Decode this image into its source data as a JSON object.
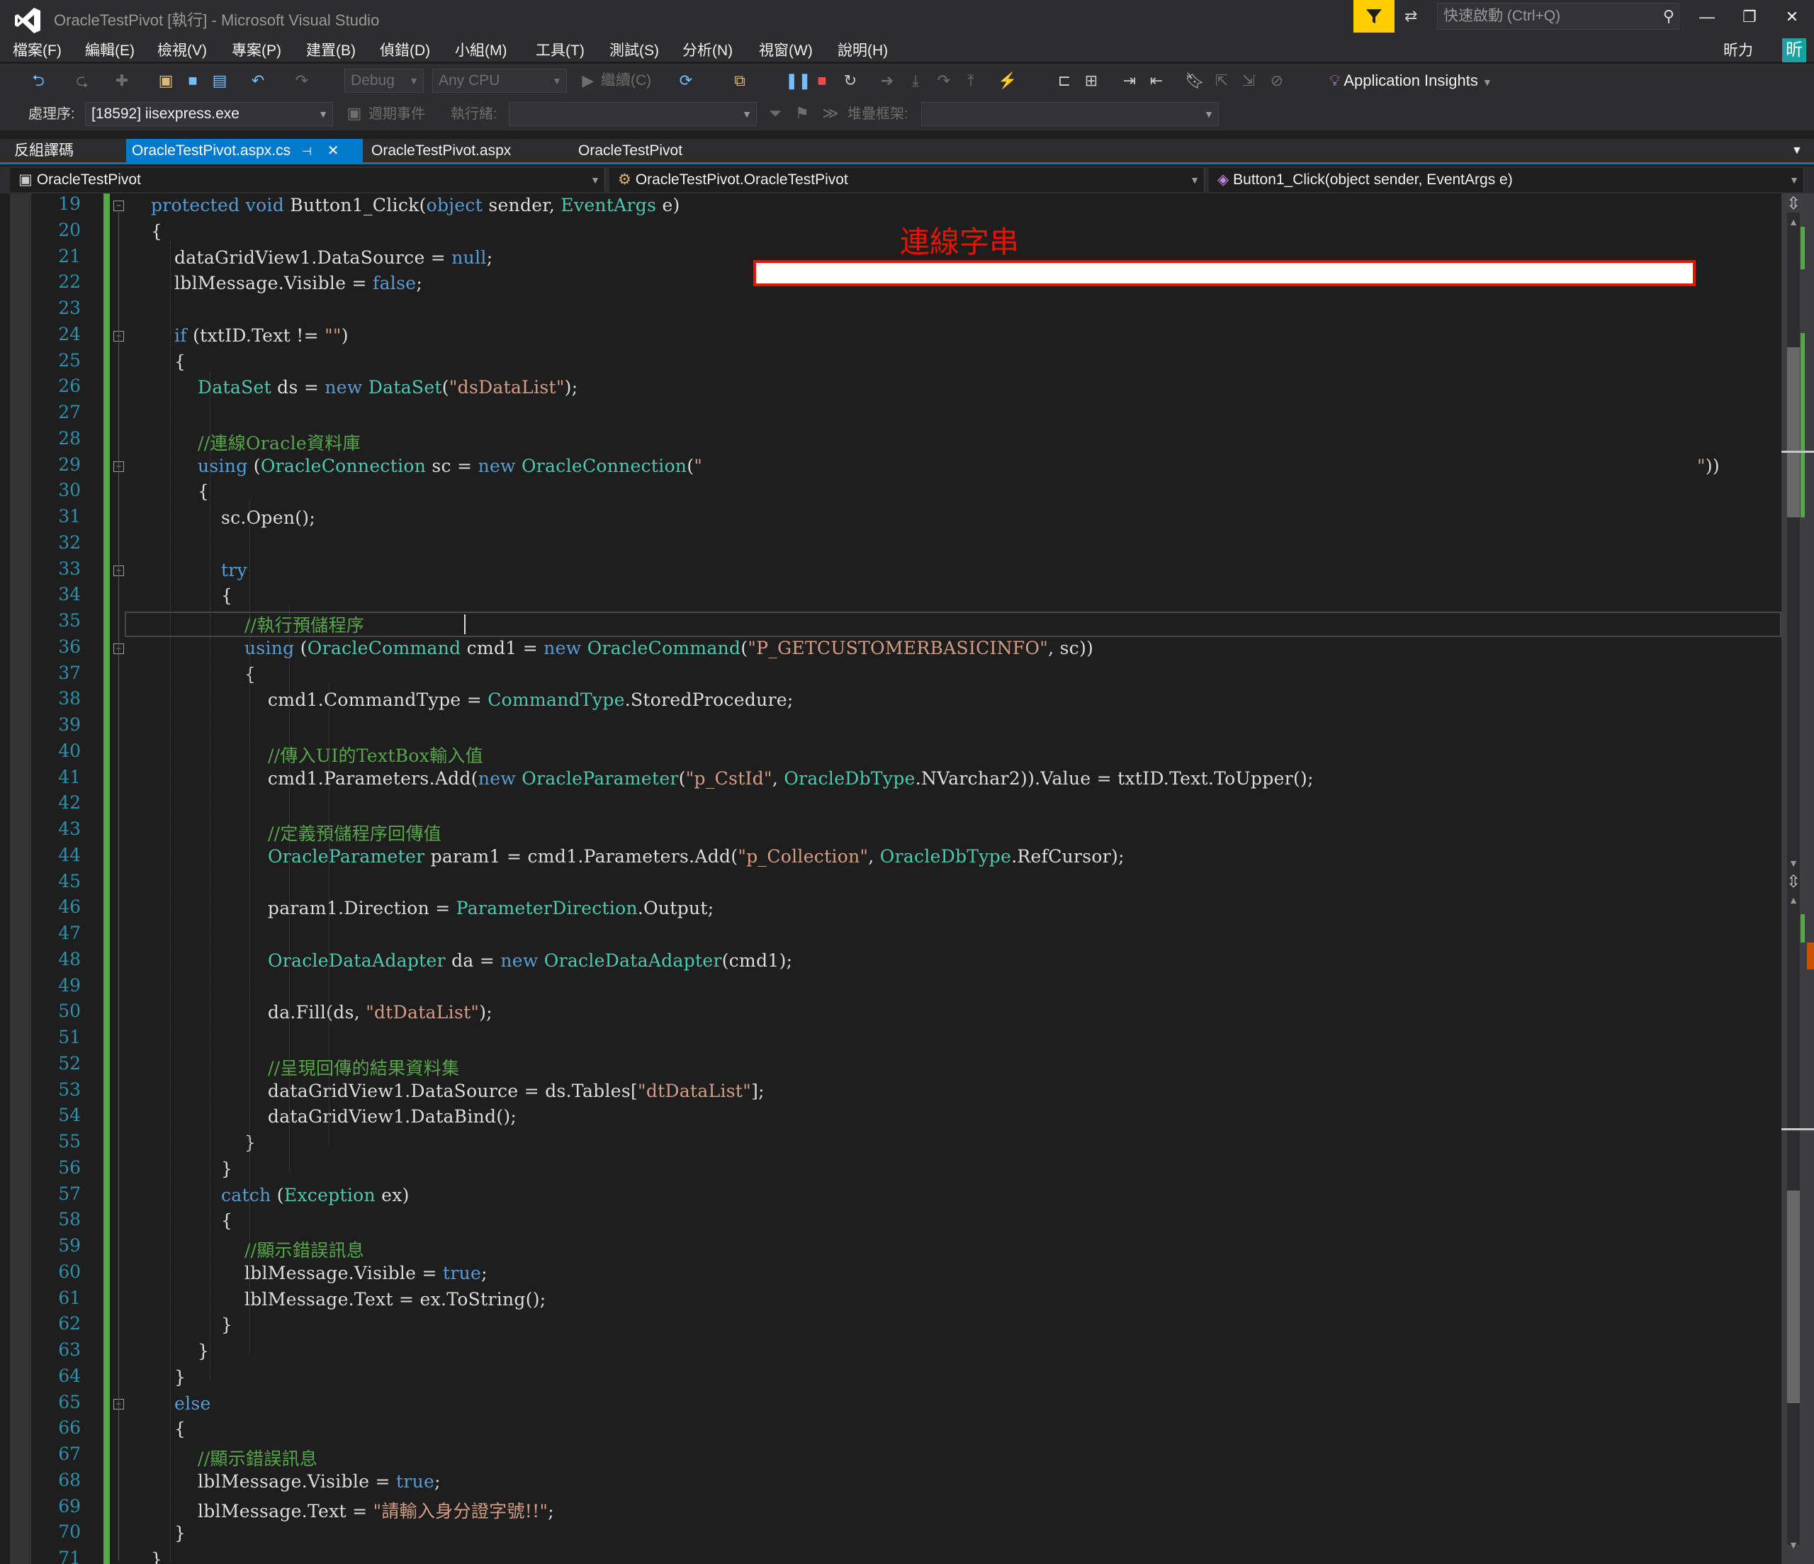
{
  "window": {
    "title": "OracleTestPivot [執行] - Microsoft Visual Studio",
    "quick_launch_placeholder": "快速啟動 (Ctrl+Q)",
    "minimize": "—",
    "maximize": "❐",
    "close": "✕"
  },
  "menu": {
    "items": [
      "檔案(F)",
      "編輯(E)",
      "檢視(V)",
      "專案(P)",
      "建置(B)",
      "偵錯(D)",
      "小組(M)",
      "工具(T)",
      "測試(S)",
      "分析(N)",
      "視窗(W)",
      "說明(H)"
    ],
    "user_name": "昕力",
    "user_avatar": "昕"
  },
  "toolbar": {
    "config": "Debug",
    "platform": "Any CPU",
    "continue_label": "繼續(C)",
    "app_insights": "Application Insights"
  },
  "debug_location": {
    "process_label": "處理序:",
    "process_value": "[18592] iisexpress.exe",
    "lifecycle_label": "週期事件",
    "thread_label": "執行緒:",
    "stack_label": "堆疊框架:"
  },
  "tabs": {
    "left_panel": "反組譯碼",
    "documents": [
      {
        "label": "OracleTestPivot.aspx.cs",
        "active": true
      },
      {
        "label": "OracleTestPivot.aspx",
        "active": false
      },
      {
        "label": "OracleTestPivot",
        "active": false
      }
    ]
  },
  "navigation": {
    "project": "OracleTestPivot",
    "type": "OracleTestPivot.OracleTestPivot",
    "member": "Button1_Click(object sender, EventArgs e)"
  },
  "annotation": {
    "label": "連線字串"
  },
  "code": {
    "lines": [
      {
        "n": 19,
        "fold": true,
        "tokens": [
          [
            "",
            "    "
          ],
          [
            "kw",
            "protected"
          ],
          [
            "",
            " "
          ],
          [
            "kw",
            "void"
          ],
          [
            "",
            " Button1_Click("
          ],
          [
            "kw",
            "object"
          ],
          [
            "",
            " sender, "
          ],
          [
            "ty",
            "EventArgs"
          ],
          [
            "",
            " e)"
          ]
        ]
      },
      {
        "n": 20,
        "tokens": [
          [
            "",
            "    {"
          ]
        ]
      },
      {
        "n": 21,
        "tokens": [
          [
            "",
            "        dataGridView1.DataSource = "
          ],
          [
            "kw",
            "null"
          ],
          [
            "",
            ";"
          ]
        ]
      },
      {
        "n": 22,
        "tokens": [
          [
            "",
            "        lblMessage.Visible = "
          ],
          [
            "kw",
            "false"
          ],
          [
            "",
            ";"
          ]
        ]
      },
      {
        "n": 23,
        "tokens": [
          [
            "",
            ""
          ]
        ]
      },
      {
        "n": 24,
        "fold": true,
        "tokens": [
          [
            "",
            "        "
          ],
          [
            "kw",
            "if"
          ],
          [
            "",
            " (txtID.Text != "
          ],
          [
            "st",
            "\"\""
          ],
          [
            "",
            ")"
          ]
        ]
      },
      {
        "n": 25,
        "tokens": [
          [
            "",
            "        {"
          ]
        ]
      },
      {
        "n": 26,
        "tokens": [
          [
            "",
            "            "
          ],
          [
            "ty",
            "DataSet"
          ],
          [
            "",
            " ds = "
          ],
          [
            "kw",
            "new"
          ],
          [
            "",
            " "
          ],
          [
            "ty",
            "DataSet"
          ],
          [
            "",
            "("
          ],
          [
            "st",
            "\"dsDataList\""
          ],
          [
            "",
            ");"
          ]
        ]
      },
      {
        "n": 27,
        "tokens": [
          [
            "",
            ""
          ]
        ]
      },
      {
        "n": 28,
        "tokens": [
          [
            "",
            "            "
          ],
          [
            "cm",
            "//連線Oracle資料庫"
          ]
        ]
      },
      {
        "n": 29,
        "fold": true,
        "tokens": [
          [
            "",
            "            "
          ],
          [
            "kw",
            "using"
          ],
          [
            "",
            " ("
          ],
          [
            "ty",
            "OracleConnection"
          ],
          [
            "",
            " sc = "
          ],
          [
            "kw",
            "new"
          ],
          [
            "",
            " "
          ],
          [
            "ty",
            "OracleConnection"
          ],
          [
            "",
            "("
          ],
          [
            "st",
            "\""
          ]
        ]
      },
      {
        "n": 30,
        "tokens": [
          [
            "",
            "            {"
          ]
        ]
      },
      {
        "n": 31,
        "tokens": [
          [
            "",
            "                sc.Open();"
          ]
        ]
      },
      {
        "n": 32,
        "tokens": [
          [
            "",
            ""
          ]
        ]
      },
      {
        "n": 33,
        "fold": true,
        "tokens": [
          [
            "",
            "                "
          ],
          [
            "kw",
            "try"
          ]
        ]
      },
      {
        "n": 34,
        "tokens": [
          [
            "",
            "                {"
          ]
        ]
      },
      {
        "n": 35,
        "tokens": [
          [
            "",
            "                    "
          ],
          [
            "cm",
            "//執行預儲程序"
          ]
        ]
      },
      {
        "n": 36,
        "fold": true,
        "tokens": [
          [
            "",
            "                    "
          ],
          [
            "kw",
            "using"
          ],
          [
            "",
            " ("
          ],
          [
            "ty",
            "OracleCommand"
          ],
          [
            "",
            " cmd1 = "
          ],
          [
            "kw",
            "new"
          ],
          [
            "",
            " "
          ],
          [
            "ty",
            "OracleCommand"
          ],
          [
            "",
            "("
          ],
          [
            "st",
            "\"P_GETCUSTOMERBASICINFO\""
          ],
          [
            "",
            ", sc))"
          ]
        ]
      },
      {
        "n": 37,
        "tokens": [
          [
            "",
            "                    {"
          ]
        ]
      },
      {
        "n": 38,
        "tokens": [
          [
            "",
            "                        cmd1.CommandType = "
          ],
          [
            "ty",
            "CommandType"
          ],
          [
            "",
            ".StoredProcedure;"
          ]
        ]
      },
      {
        "n": 39,
        "tokens": [
          [
            "",
            ""
          ]
        ]
      },
      {
        "n": 40,
        "tokens": [
          [
            "",
            "                        "
          ],
          [
            "cm",
            "//傳入UI的TextBox輸入值"
          ]
        ]
      },
      {
        "n": 41,
        "tokens": [
          [
            "",
            "                        cmd1.Parameters.Add("
          ],
          [
            "kw",
            "new"
          ],
          [
            "",
            " "
          ],
          [
            "ty",
            "OracleParameter"
          ],
          [
            "",
            "("
          ],
          [
            "st",
            "\"p_CstId\""
          ],
          [
            "",
            ", "
          ],
          [
            "ty",
            "OracleDbType"
          ],
          [
            "",
            ".NVarchar2)).Value = txtID.Text.ToUpper();"
          ]
        ]
      },
      {
        "n": 42,
        "tokens": [
          [
            "",
            ""
          ]
        ]
      },
      {
        "n": 43,
        "tokens": [
          [
            "",
            "                        "
          ],
          [
            "cm",
            "//定義預儲程序回傳值"
          ]
        ]
      },
      {
        "n": 44,
        "tokens": [
          [
            "",
            "                        "
          ],
          [
            "ty",
            "OracleParameter"
          ],
          [
            "",
            " param1 = cmd1.Parameters.Add("
          ],
          [
            "st",
            "\"p_Collection\""
          ],
          [
            "",
            ", "
          ],
          [
            "ty",
            "OracleDbType"
          ],
          [
            "",
            ".RefCursor);"
          ]
        ]
      },
      {
        "n": 45,
        "tokens": [
          [
            "",
            ""
          ]
        ]
      },
      {
        "n": 46,
        "tokens": [
          [
            "",
            "                        param1.Direction = "
          ],
          [
            "ty",
            "ParameterDirection"
          ],
          [
            "",
            ".Output;"
          ]
        ]
      },
      {
        "n": 47,
        "tokens": [
          [
            "",
            ""
          ]
        ]
      },
      {
        "n": 48,
        "tokens": [
          [
            "",
            "                        "
          ],
          [
            "ty",
            "OracleDataAdapter"
          ],
          [
            "",
            " da = "
          ],
          [
            "kw",
            "new"
          ],
          [
            "",
            " "
          ],
          [
            "ty",
            "OracleDataAdapter"
          ],
          [
            "",
            "(cmd1);"
          ]
        ]
      },
      {
        "n": 49,
        "tokens": [
          [
            "",
            ""
          ]
        ]
      },
      {
        "n": 50,
        "tokens": [
          [
            "",
            "                        da.Fill(ds, "
          ],
          [
            "st",
            "\"dtDataList\""
          ],
          [
            "",
            ");"
          ]
        ]
      },
      {
        "n": 51,
        "tokens": [
          [
            "",
            ""
          ]
        ]
      },
      {
        "n": 52,
        "tokens": [
          [
            "",
            "                        "
          ],
          [
            "cm",
            "//呈現回傳的結果資料集"
          ]
        ]
      },
      {
        "n": 53,
        "tokens": [
          [
            "",
            "                        dataGridView1.DataSource = ds.Tables["
          ],
          [
            "st",
            "\"dtDataList\""
          ],
          [
            "",
            "];"
          ]
        ]
      },
      {
        "n": 54,
        "tokens": [
          [
            "",
            "                        dataGridView1.DataBind();"
          ]
        ]
      },
      {
        "n": 55,
        "tokens": [
          [
            "",
            "                    }"
          ]
        ]
      },
      {
        "n": 56,
        "tokens": [
          [
            "",
            "                }"
          ]
        ]
      },
      {
        "n": 57,
        "tokens": [
          [
            "",
            "                "
          ],
          [
            "kw",
            "catch"
          ],
          [
            "",
            " ("
          ],
          [
            "ty",
            "Exception"
          ],
          [
            "",
            " ex)"
          ]
        ]
      },
      {
        "n": 58,
        "tokens": [
          [
            "",
            "                {"
          ]
        ]
      },
      {
        "n": 59,
        "tokens": [
          [
            "",
            "                    "
          ],
          [
            "cm",
            "//顯示錯誤訊息"
          ]
        ]
      },
      {
        "n": 60,
        "tokens": [
          [
            "",
            "                    lblMessage.Visible = "
          ],
          [
            "kw",
            "true"
          ],
          [
            "",
            ";"
          ]
        ]
      },
      {
        "n": 61,
        "tokens": [
          [
            "",
            "                    lblMessage.Text = ex.ToString();"
          ]
        ]
      },
      {
        "n": 62,
        "tokens": [
          [
            "",
            "                }"
          ]
        ]
      },
      {
        "n": 63,
        "tokens": [
          [
            "",
            "            }"
          ]
        ]
      },
      {
        "n": 64,
        "tokens": [
          [
            "",
            "        }"
          ]
        ]
      },
      {
        "n": 65,
        "fold": true,
        "tokens": [
          [
            "",
            "        "
          ],
          [
            "kw",
            "else"
          ]
        ]
      },
      {
        "n": 66,
        "tokens": [
          [
            "",
            "        {"
          ]
        ]
      },
      {
        "n": 67,
        "tokens": [
          [
            "",
            "            "
          ],
          [
            "cm",
            "//顯示錯誤訊息"
          ]
        ]
      },
      {
        "n": 68,
        "tokens": [
          [
            "",
            "            lblMessage.Visible = "
          ],
          [
            "kw",
            "true"
          ],
          [
            "",
            ";"
          ]
        ]
      },
      {
        "n": 69,
        "tokens": [
          [
            "",
            "            lblMessage.Text = "
          ],
          [
            "st",
            "\"請輸入身分證字號!!\""
          ],
          [
            "",
            ";"
          ]
        ]
      },
      {
        "n": 70,
        "tokens": [
          [
            "",
            "        }"
          ]
        ]
      },
      {
        "n": 71,
        "tokens": [
          [
            "",
            "    }"
          ]
        ]
      }
    ],
    "line29_tail": "\"))"
  }
}
